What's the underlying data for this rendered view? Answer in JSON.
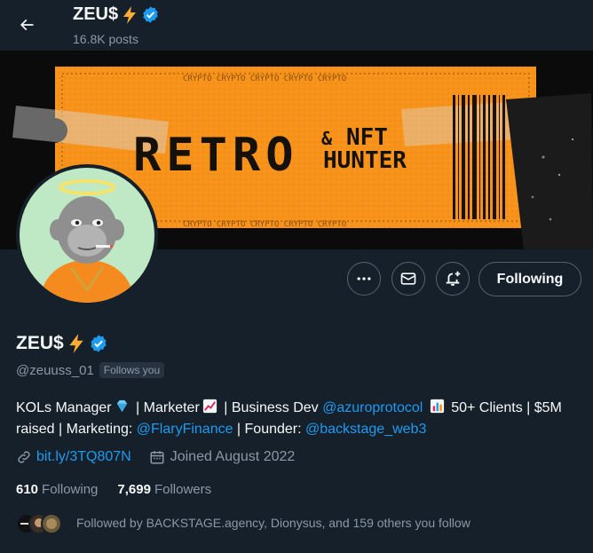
{
  "header": {
    "title": "ZEU$",
    "posts_count": "16.8K posts"
  },
  "banner": {
    "headline": "RETRO",
    "amp": "&",
    "line1": "NFT",
    "line2": "HUNTER",
    "repeat_text": "CRYPTO CRYPTO CRYPTO CRYPTO CRYPTO"
  },
  "actions": {
    "more_icon": "more-dots-icon",
    "message_icon": "envelope-icon",
    "notify_icon": "bell-plus-icon",
    "following_label": "Following"
  },
  "profile": {
    "display_name": "ZEU$",
    "handle": "@zeuuss_01",
    "follows_you": "Follows you",
    "bio": {
      "p1": "KOLs Manager",
      "p2": " | Marketer",
      "p3": " | Business Dev",
      "mention1": "@azuroprotocol",
      "p4": " 50+ Clients | $5M raised | Marketing: ",
      "mention2": "@FlaryFinance",
      "p5": " | Founder: ",
      "mention3": "@backstage_web3"
    },
    "website": "bit.ly/3TQ807N",
    "joined": "Joined August 2022",
    "following_count": "610",
    "following_label": "Following",
    "followers_count": "7,699",
    "followers_label": "Followers",
    "followed_by": "Followed by BACKSTAGE.agency, Dionysus, and 159 others you follow"
  },
  "colors": {
    "background": "#15202b",
    "accent": "#1d9bf0",
    "muted": "#8b98a5",
    "banner_orange": "#f7931a"
  }
}
